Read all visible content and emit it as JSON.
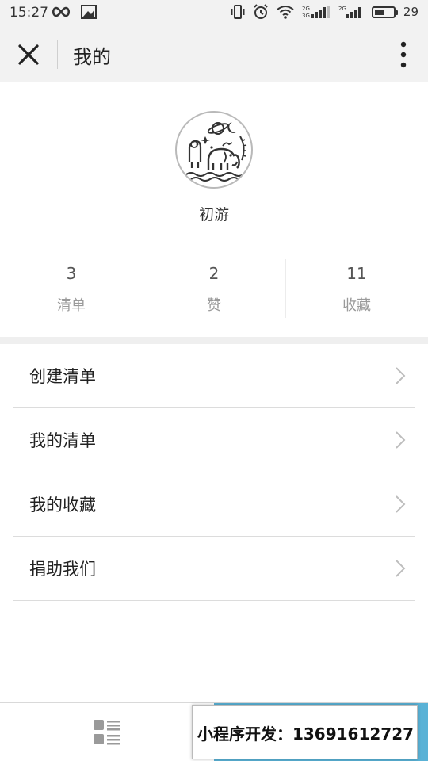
{
  "status_bar": {
    "time": "15:27",
    "battery": "29",
    "battery_level": 0.5
  },
  "header": {
    "title": "我的"
  },
  "profile": {
    "username": "初游"
  },
  "stats": [
    {
      "value": "3",
      "label": "清单"
    },
    {
      "value": "2",
      "label": "赞"
    },
    {
      "value": "11",
      "label": "收藏"
    }
  ],
  "menu": [
    {
      "label": "创建清单"
    },
    {
      "label": "我的清单"
    },
    {
      "label": "我的收藏"
    },
    {
      "label": "捐助我们"
    }
  ],
  "tab_bar": {
    "left_icon": "list-icon",
    "right_color": "#5ab2d6"
  },
  "promo": {
    "text": "小程序开发：13691612727"
  }
}
